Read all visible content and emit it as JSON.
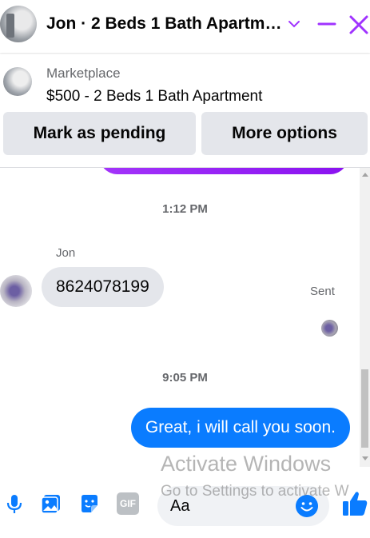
{
  "header": {
    "title": "Jon · 2 Beds 1 Bath Apartm…",
    "accent_color": "#a033ff"
  },
  "listing": {
    "source": "Marketplace",
    "price_title": "$500 - 2 Beds 1 Bath Apartment",
    "buttons": {
      "pending": "Mark as pending",
      "more": "More options"
    }
  },
  "messages": {
    "timestamp_1": "1:12 PM",
    "sender_name": "Jon",
    "their_message": "8624078199",
    "timestamp_2": "9:05 PM",
    "my_message": "Great, i will call you soon.",
    "status": "Sent",
    "my_bubble_color": "#0a7cff",
    "their_bubble_color": "#e4e6eb"
  },
  "composer": {
    "placeholder": "Aa",
    "icons": [
      "microphone-icon",
      "photo-icon",
      "sticker-icon",
      "gif-icon",
      "emoji-icon",
      "like-icon"
    ],
    "gif_label": "GIF",
    "icon_color": "#0a7cff"
  },
  "watermark": {
    "line1": "Activate Windows",
    "line2": "Go to Settings to activate W"
  }
}
